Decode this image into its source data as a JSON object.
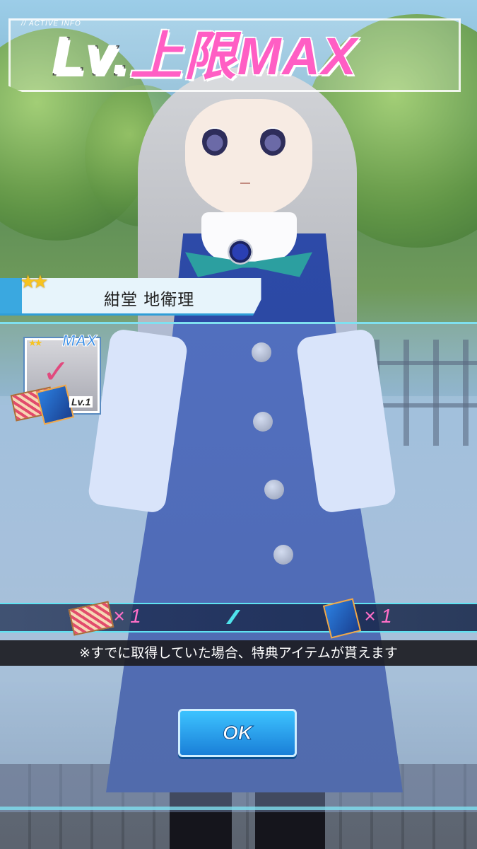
{
  "header": {
    "subtitle": "// ACTIVE INFO",
    "title_prefix": "Lv.",
    "title_main": "上限MAX"
  },
  "character": {
    "rarity_stars": "★★",
    "name": "紺堂 地衛理"
  },
  "card": {
    "stars": "★★",
    "max_label": "MAX",
    "level_label": "Lv.1",
    "check_icon": "✓"
  },
  "rewards": {
    "items": [
      {
        "icon": "ticket-icon",
        "count_label": "× 1"
      },
      {
        "icon": "book-icon",
        "count_label": "× 1"
      }
    ]
  },
  "notice": "※すでに取得していた場合、特典アイテムが貰えます",
  "ok_button": "OK",
  "colors": {
    "accent_pink": "#ff5ec4",
    "accent_cyan": "#5fe3f2",
    "button_blue": "#1a7fd8"
  }
}
